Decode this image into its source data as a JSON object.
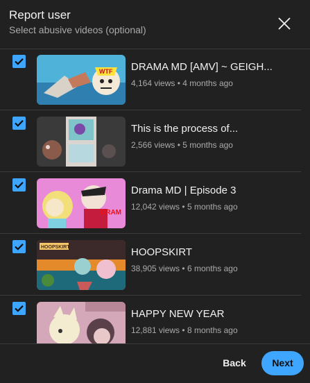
{
  "dialog": {
    "title": "Report user",
    "subtitle": "Select abusive videos (optional)"
  },
  "videos": [
    {
      "title": "DRAMA MD [AMV] ~ GEIGH...",
      "views": "4,164 views",
      "age": "4 months ago",
      "checked": true
    },
    {
      "title": "This is the process of...",
      "views": "2,566 views",
      "age": "5 months ago",
      "checked": true
    },
    {
      "title": "Drama MD | Episode 3",
      "views": "12,042 views",
      "age": "5 months ago",
      "checked": true
    },
    {
      "title": "HOOPSKIRT",
      "views": "38,905 views",
      "age": "6 months ago",
      "checked": true
    },
    {
      "title": "HAPPY NEW YEAR",
      "views": "12,881 views",
      "age": "8 months ago",
      "checked": true
    }
  ],
  "meta_separator": "•",
  "footer": {
    "back_label": "Back",
    "next_label": "Next"
  },
  "colors": {
    "background": "#212121",
    "accent": "#3ea6ff",
    "divider": "#3d3d3d"
  },
  "icons": {
    "close": "close-icon",
    "check": "check-icon"
  }
}
